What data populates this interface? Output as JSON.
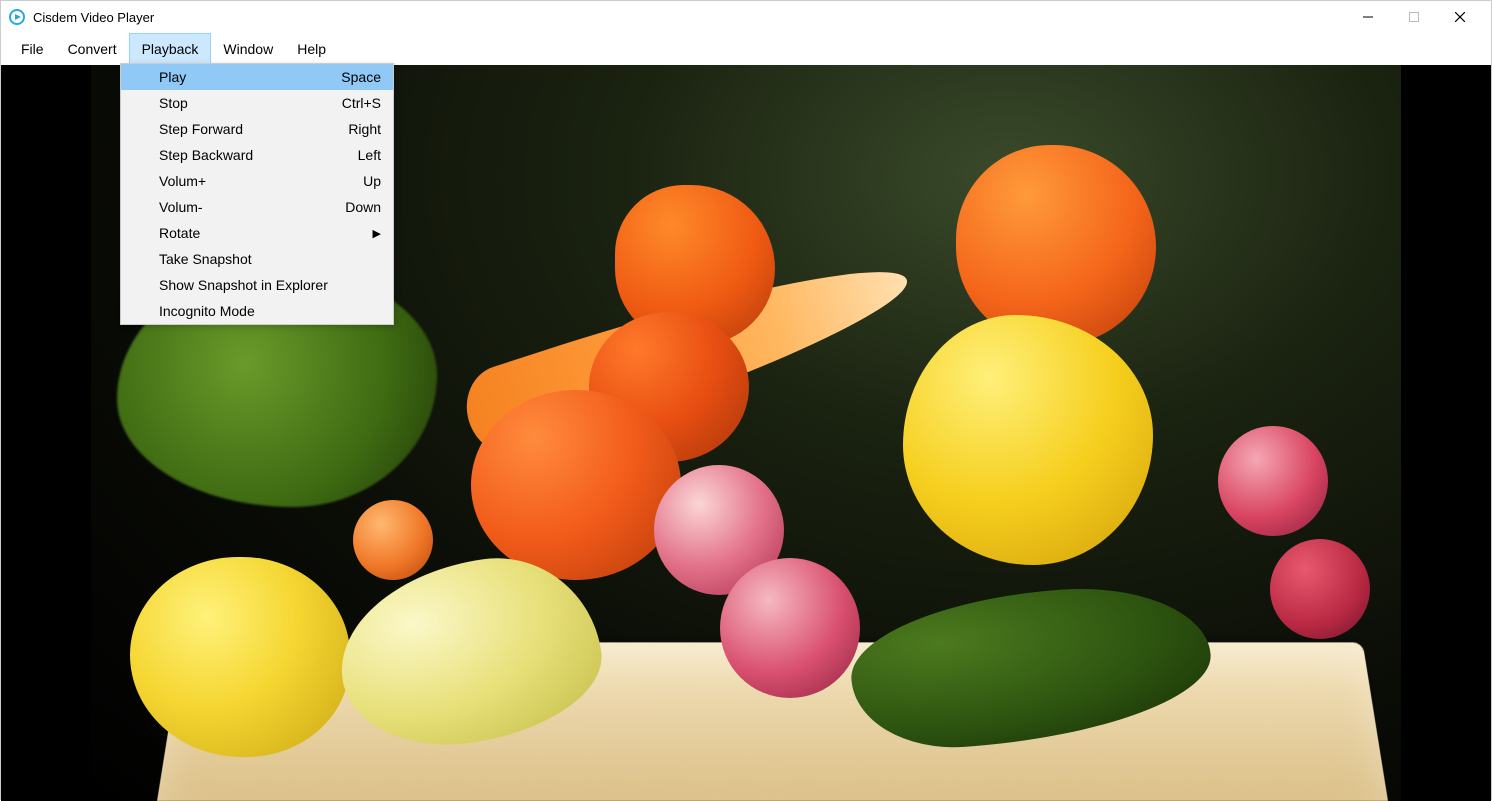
{
  "app": {
    "title": "Cisdem Video Player"
  },
  "menubar": {
    "items": [
      {
        "label": "File"
      },
      {
        "label": "Convert"
      },
      {
        "label": "Playback",
        "active": true
      },
      {
        "label": "Window"
      },
      {
        "label": "Help"
      }
    ]
  },
  "dropdown": {
    "open_menu": "Playback",
    "items": [
      {
        "label": "Play",
        "shortcut": "Space",
        "highlight": true
      },
      {
        "label": "Stop",
        "shortcut": "Ctrl+S"
      },
      {
        "label": "Step Forward",
        "shortcut": "Right"
      },
      {
        "label": "Step Backward",
        "shortcut": "Left"
      },
      {
        "label": "Volum+",
        "shortcut": "Up"
      },
      {
        "label": "Volum-",
        "shortcut": "Down"
      },
      {
        "label": "Rotate",
        "submenu": true
      },
      {
        "label": "Take Snapshot"
      },
      {
        "label": "Show Snapshot in Explorer"
      },
      {
        "label": "Incognito Mode"
      }
    ]
  },
  "window_controls": {
    "minimize": "—",
    "maximize": "□",
    "close": "✕"
  }
}
